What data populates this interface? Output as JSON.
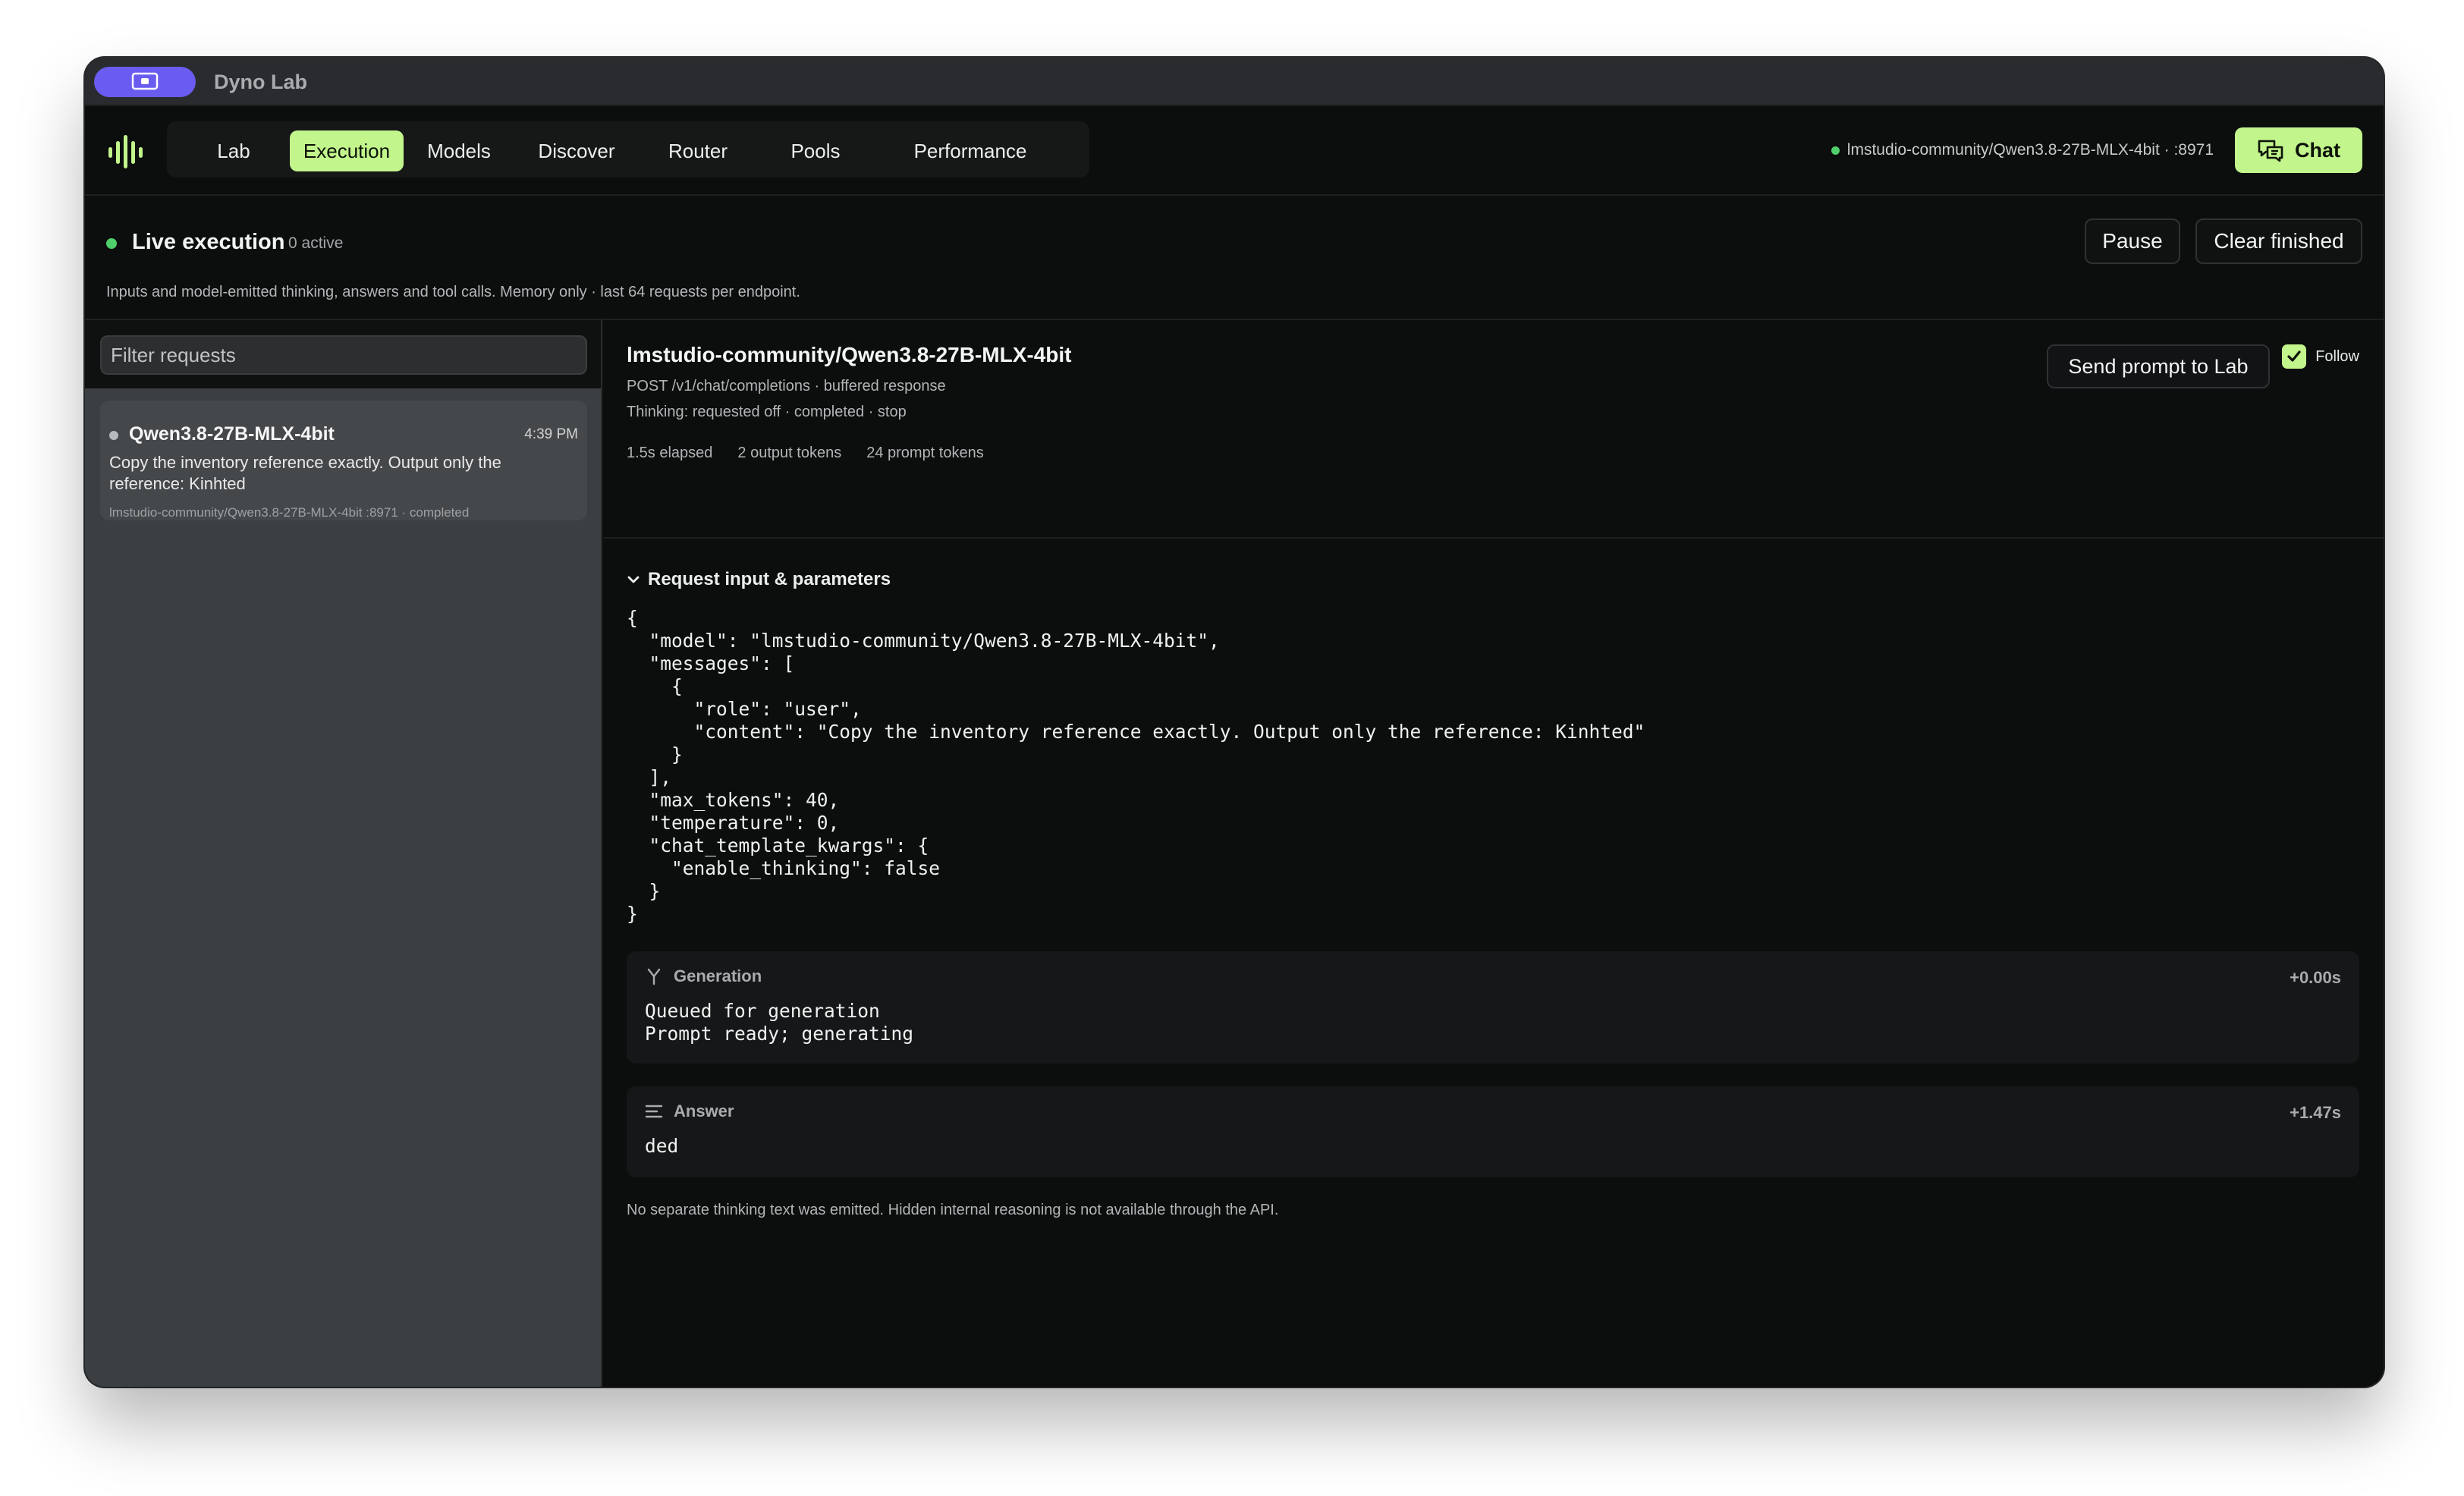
{
  "window": {
    "title": "Dyno Lab"
  },
  "nav": {
    "items": [
      {
        "label": "Lab"
      },
      {
        "label": "Execution"
      },
      {
        "label": "Models"
      },
      {
        "label": "Discover"
      },
      {
        "label": "Router"
      },
      {
        "label": "Pools"
      },
      {
        "label": "Performance"
      }
    ],
    "active": "Execution",
    "endpoint": "lmstudio-community/Qwen3.8-27B-MLX-4bit · :8971",
    "chat_label": "Chat"
  },
  "live": {
    "title": "Live execution",
    "active_count": "0 active",
    "description": "Inputs and model-emitted thinking, answers and tool calls. Memory only · last 64 requests per endpoint.",
    "pause_label": "Pause",
    "clear_label": "Clear finished"
  },
  "sidebar": {
    "filter_placeholder": "Filter requests",
    "requests": [
      {
        "model": "Qwen3.8-27B-MLX-4bit",
        "time": "4:39 PM",
        "prompt": "Copy the inventory reference exactly. Output only the reference: Kinhted",
        "meta": "lmstudio-community/Qwen3.8-27B-MLX-4bit :8971 · completed"
      }
    ]
  },
  "detail": {
    "title": "lmstudio-community/Qwen3.8-27B-MLX-4bit",
    "request_line": "POST /v1/chat/completions · buffered response",
    "thinking_line": "Thinking: requested off · completed · stop",
    "stats": [
      "1.5s elapsed",
      "2 output tokens",
      "24 prompt tokens"
    ],
    "send_label": "Send prompt to Lab",
    "follow_label": "Follow",
    "follow_checked": true,
    "params_label": "Request input & parameters",
    "params_json": "{\n  \"model\": \"lmstudio-community/Qwen3.8-27B-MLX-4bit\",\n  \"messages\": [\n    {\n      \"role\": \"user\",\n      \"content\": \"Copy the inventory reference exactly. Output only the reference: Kinhted\"\n    }\n  ],\n  \"max_tokens\": 40,\n  \"temperature\": 0,\n  \"chat_template_kwargs\": {\n    \"enable_thinking\": false\n  }\n}",
    "generation": {
      "label": "Generation",
      "time": "+0.00s",
      "body": "Queued for generation\nPrompt ready; generating"
    },
    "answer": {
      "label": "Answer",
      "time": "+1.47s",
      "body": "ded"
    },
    "footnote": "No separate thinking text was emitted. Hidden internal reasoning is not available through the API."
  },
  "colors": {
    "accent": "#c2f58c",
    "status_green": "#4fcf6b",
    "titlebar_pill": "#6a5cf0"
  }
}
